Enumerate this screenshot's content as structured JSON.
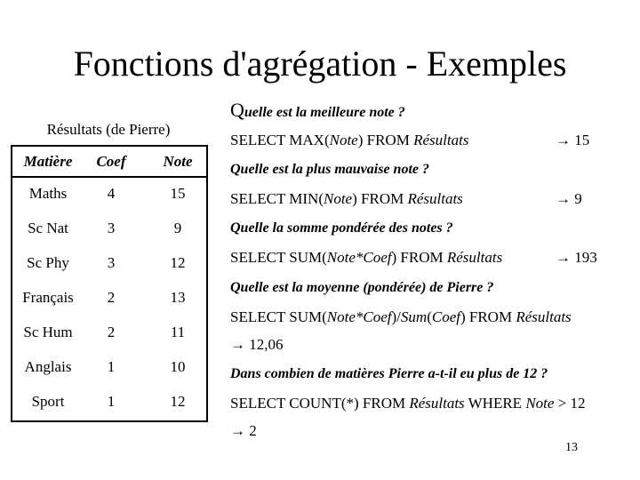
{
  "slide": {
    "title": "Fonctions d'agrégation - Exemples",
    "page_number": "13"
  },
  "table": {
    "caption": "Résultats (de Pierre)",
    "headers": [
      "Matière",
      "Coef",
      "Note"
    ],
    "rows": [
      [
        "Maths",
        "4",
        "15"
      ],
      [
        "Sc Nat",
        "3",
        "9"
      ],
      [
        "Sc Phy",
        "3",
        "12"
      ],
      [
        "Français",
        "2",
        "13"
      ],
      [
        "Sc Hum",
        "2",
        "11"
      ],
      [
        "Anglais",
        "1",
        "10"
      ],
      [
        "Sport",
        "1",
        "12"
      ]
    ]
  },
  "examples": [
    {
      "question_first": "Q",
      "question_rest": "uelle est la meilleure note ?",
      "sql": [
        "SELECT MAX(",
        "Note",
        ") FROM ",
        "Résultats"
      ],
      "result": "→ 15"
    },
    {
      "question": "Quelle est la plus mauvaise note ?",
      "sql": [
        "SELECT MIN(",
        "Note",
        ") FROM ",
        "Résultats"
      ],
      "result": "→ 9"
    },
    {
      "question": "Quelle la somme pondérée des notes ?",
      "sql": [
        "SELECT SUM(",
        "Note*Coef",
        ") FROM ",
        "Résultats"
      ],
      "result": "→ 193"
    },
    {
      "question": "Quelle est la moyenne (pondérée) de Pierre ?",
      "sql": [
        "SELECT SUM(",
        "Note*Coef",
        ")/",
        "Sum",
        "(",
        "Coef",
        ") FROM ",
        "Résultats"
      ],
      "result": "→ 12,06"
    },
    {
      "question": "Dans combien de matières Pierre a-t-il eu plus de 12 ?",
      "sql": [
        "SELECT COUNT(*) FROM ",
        "Résultats",
        " WHERE ",
        "Note",
        " > 12"
      ],
      "result": "→ 2"
    }
  ]
}
